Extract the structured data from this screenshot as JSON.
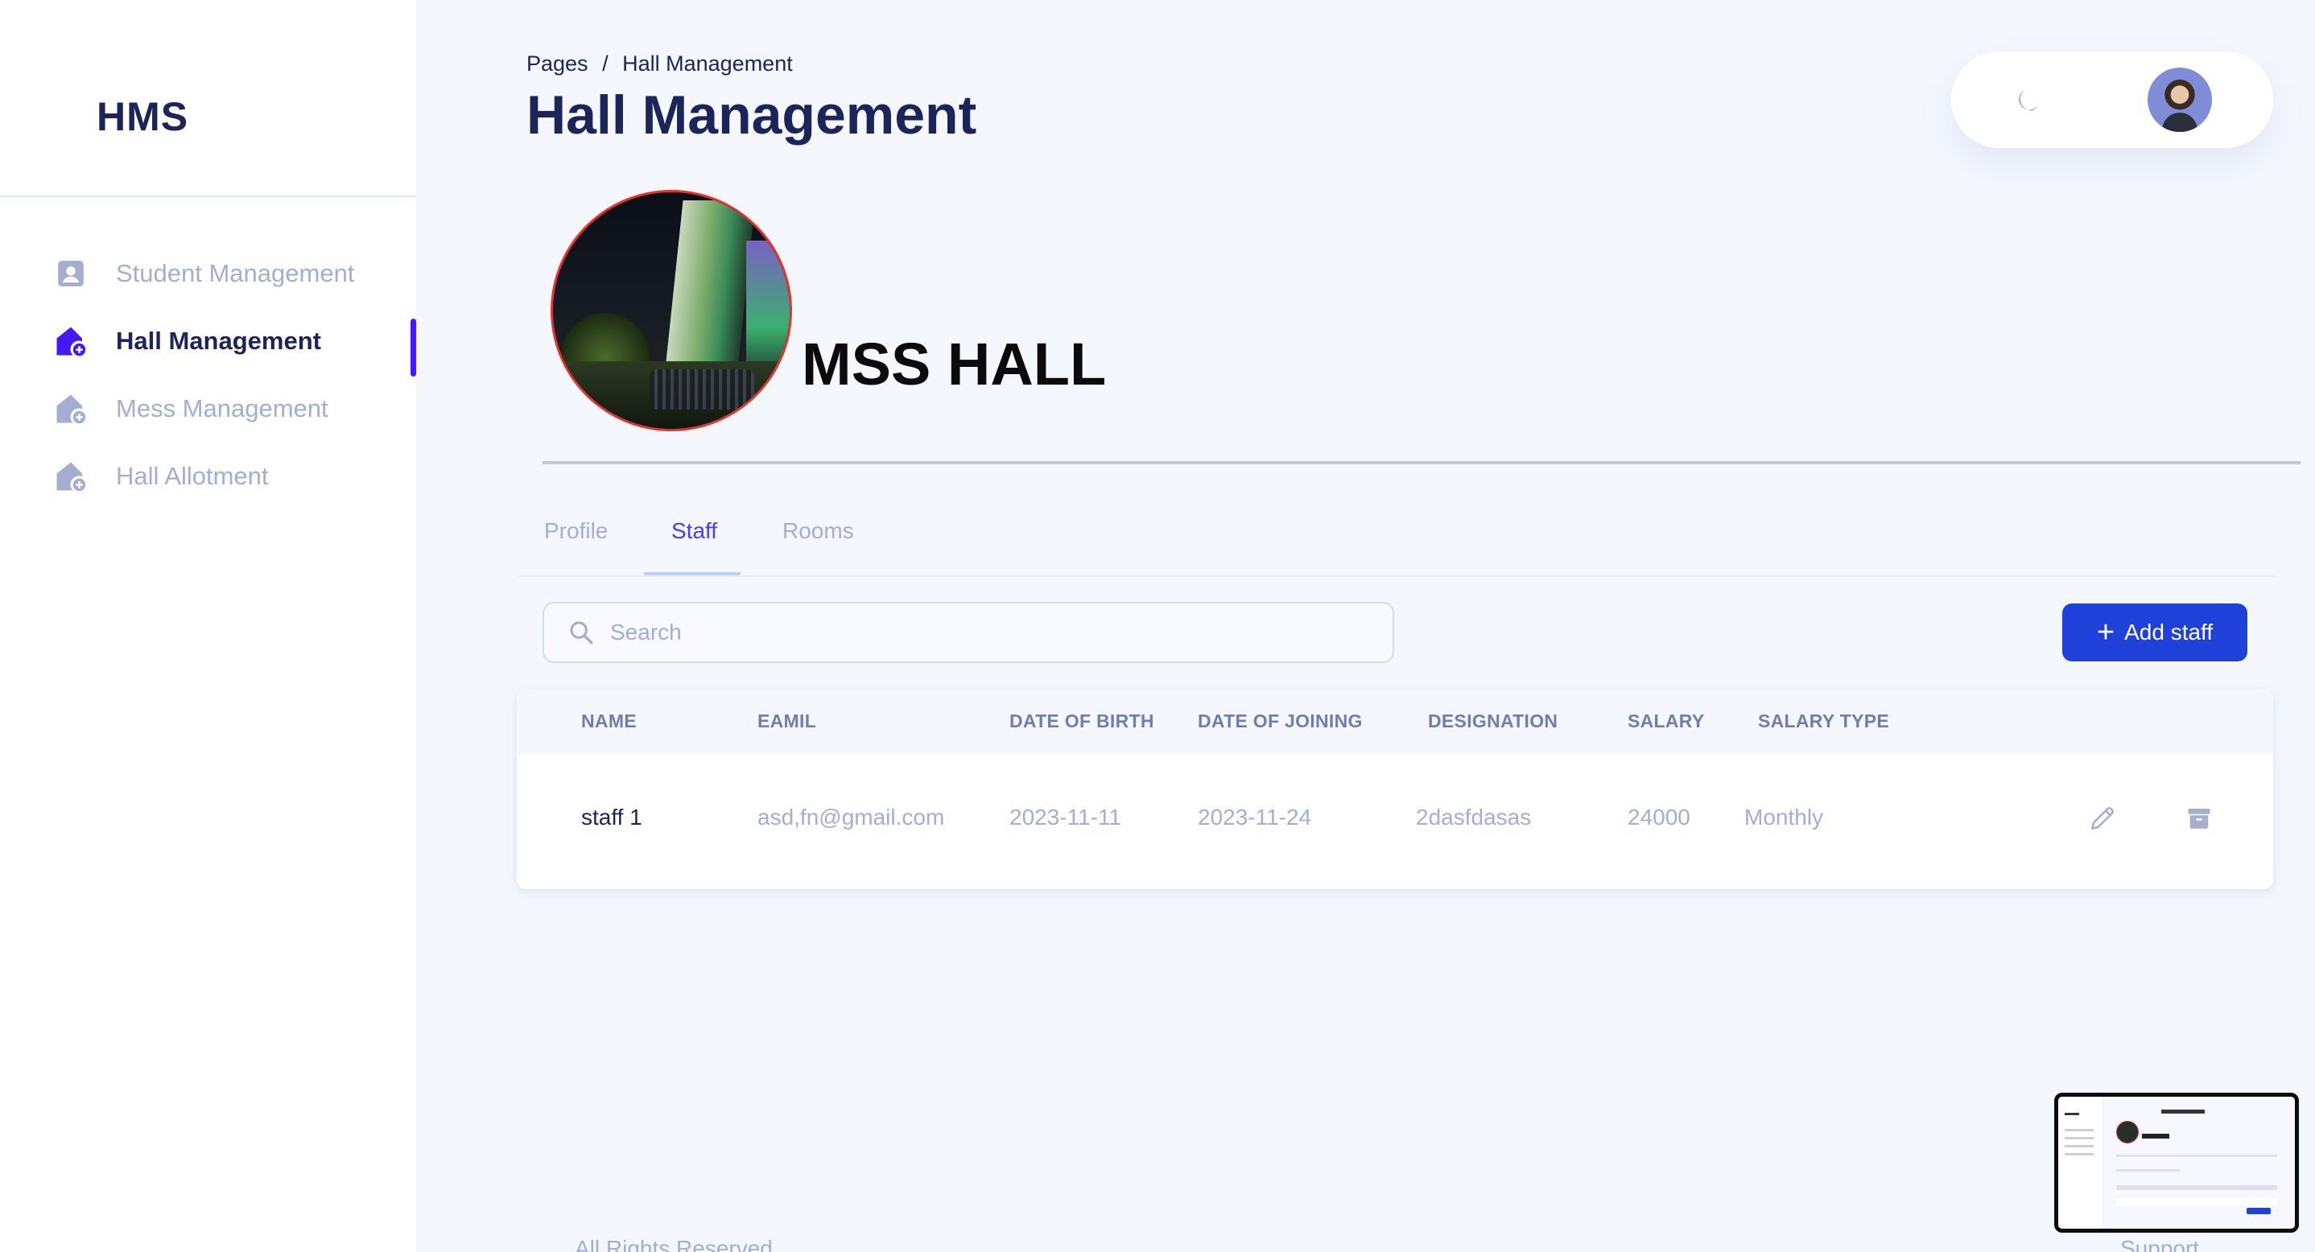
{
  "app": {
    "logo": "HMS"
  },
  "sidebar": {
    "items": [
      {
        "label": "Student Management",
        "icon": "person-badge-icon",
        "active": false
      },
      {
        "label": "Hall Management",
        "icon": "home-add-icon",
        "active": true
      },
      {
        "label": "Mess Management",
        "icon": "home-add-icon",
        "active": false
      },
      {
        "label": "Hall Allotment",
        "icon": "home-add-icon",
        "active": false
      }
    ]
  },
  "header": {
    "breadcrumb_root": "Pages",
    "breadcrumb_sep": "/",
    "breadcrumb_current": "Hall Management",
    "title": "Hall Management"
  },
  "hall": {
    "name": "MSS HALL"
  },
  "tabs": [
    {
      "label": "Profile",
      "active": false
    },
    {
      "label": "Staff",
      "active": true
    },
    {
      "label": "Rooms",
      "active": false
    }
  ],
  "search": {
    "placeholder": "Search",
    "value": ""
  },
  "toolbar": {
    "add_label": "Add staff"
  },
  "table": {
    "columns": [
      "NAME",
      "EAMIL",
      "DATE OF BIRTH",
      "DATE OF JOINING",
      "DESIGNATION",
      "SALARY",
      "SALARY TYPE"
    ],
    "rows": [
      {
        "name": "staff 1",
        "email": "asd,fn@gmail.com",
        "dob": "2023-11-11",
        "doj": "2023-11-24",
        "designation": "2dasfdasas",
        "salary": "24000",
        "salary_type": "Monthly"
      }
    ]
  },
  "footer": {
    "left": "All Rights Reserved",
    "right": "Support"
  },
  "colors": {
    "accent": "#4318ff",
    "primary_button": "#2041d9",
    "title": "#1b2559",
    "muted": "#a3aed0",
    "background": "#f4f7fe"
  }
}
